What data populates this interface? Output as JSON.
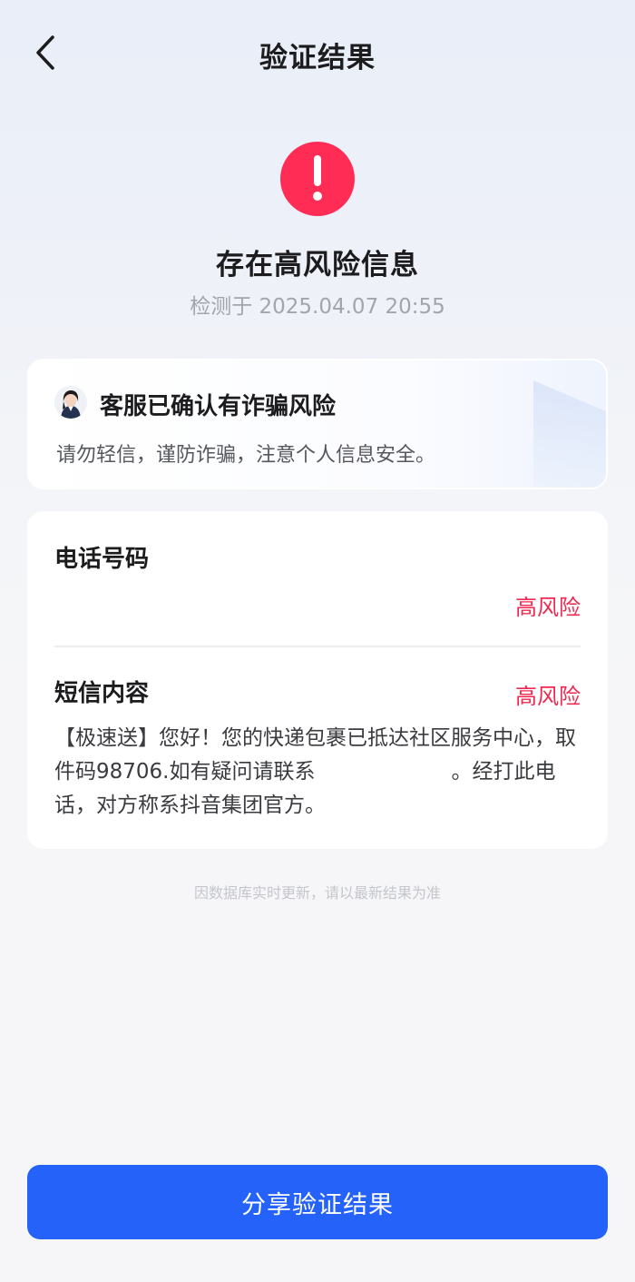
{
  "header": {
    "title": "验证结果",
    "back_icon": "chevron-left-icon"
  },
  "status": {
    "icon": "exclamation-icon",
    "title": "存在高风险信息",
    "detected_at": "检测于 2025.04.07 20:55"
  },
  "confirm_card": {
    "avatar": "agent-avatar",
    "title": "客服已确认有诈骗风险",
    "description": "请勿轻信，谨防诈骗，注意个人信息安全。"
  },
  "detail_card": {
    "phone": {
      "label": "电话号码",
      "risk_label": "高风险"
    },
    "sms": {
      "label": "短信内容",
      "risk_label": "高风险",
      "content_part1": "【极速送】您好！您的快递包裹已抵达社区服务中心，取件码98706.如有疑问请联系",
      "content_part2": "。经打此电话，对方称系抖音集团官方。"
    }
  },
  "footnote": "因数据库实时更新，请以最新结果为准",
  "share_button": "分享验证结果",
  "colors": {
    "danger": "#ff2d55",
    "risk_text": "#f0284f",
    "primary": "#2462fa"
  }
}
